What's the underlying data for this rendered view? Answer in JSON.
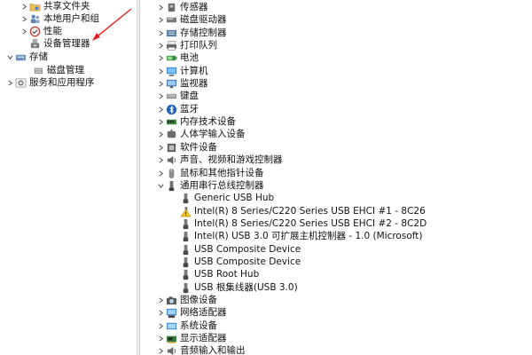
{
  "left_tree": {
    "items": [
      {
        "label": "共享文件夹",
        "icon": "shared-folder-icon",
        "expander": "collapsed"
      },
      {
        "label": "本地用户和组",
        "icon": "users-icon",
        "expander": "collapsed"
      },
      {
        "label": "性能",
        "icon": "performance-icon",
        "expander": "collapsed"
      },
      {
        "label": "设备管理器",
        "icon": "device-manager-icon",
        "expander": "none",
        "selected": false
      },
      {
        "label": "存储",
        "icon": "storage-icon",
        "expander": "expanded"
      },
      {
        "label": "磁盘管理",
        "icon": "disk-management-icon",
        "expander": "none"
      },
      {
        "label": "服务和应用程序",
        "icon": "services-icon",
        "expander": "collapsed"
      }
    ],
    "annotation_arrow_color": "#e02020"
  },
  "device_tree": {
    "categories_top": [
      {
        "label": "传感器",
        "icon": "sensor-icon"
      },
      {
        "label": "磁盘驱动器",
        "icon": "disk-drive-icon"
      },
      {
        "label": "存储控制器",
        "icon": "storage-controller-icon"
      },
      {
        "label": "打印队列",
        "icon": "printer-icon"
      },
      {
        "label": "电池",
        "icon": "battery-icon"
      },
      {
        "label": "计算机",
        "icon": "computer-icon"
      },
      {
        "label": "监视器",
        "icon": "monitor-icon"
      },
      {
        "label": "键盘",
        "icon": "keyboard-icon"
      },
      {
        "label": "蓝牙",
        "icon": "bluetooth-icon"
      },
      {
        "label": "内存技术设备",
        "icon": "memory-device-icon"
      },
      {
        "label": "人体学输入设备",
        "icon": "hid-icon"
      },
      {
        "label": "软件设备",
        "icon": "software-device-icon"
      },
      {
        "label": "声音、视频和游戏控制器",
        "icon": "sound-icon"
      },
      {
        "label": "鼠标和其他指针设备",
        "icon": "mouse-icon"
      }
    ],
    "usb_category": {
      "label": "通用串行总线控制器",
      "icon": "usb-icon",
      "expander": "expanded"
    },
    "usb_children": [
      {
        "label": "Generic USB Hub",
        "icon": "usb-device-icon"
      },
      {
        "label": "Intel(R) 8 Series/C220 Series USB EHCI #1 - 8C26",
        "icon": "warning-usb-icon"
      },
      {
        "label": "Intel(R) 8 Series/C220 Series USB EHCI #2 - 8C2D",
        "icon": "usb-device-icon"
      },
      {
        "label": "Intel(R) USB 3.0 可扩展主机控制器 - 1.0 (Microsoft)",
        "icon": "usb-device-icon"
      },
      {
        "label": "USB Composite Device",
        "icon": "usb-device-icon"
      },
      {
        "label": "USB Composite Device",
        "icon": "usb-device-icon"
      },
      {
        "label": "USB Root Hub",
        "icon": "usb-device-icon"
      },
      {
        "label": "USB 根集线器(USB 3.0)",
        "icon": "usb-device-icon"
      }
    ],
    "categories_bottom": [
      {
        "label": "图像设备",
        "icon": "camera-icon"
      },
      {
        "label": "网络适配器",
        "icon": "network-adapter-icon"
      },
      {
        "label": "系统设备",
        "icon": "system-device-icon"
      },
      {
        "label": "显示适配器",
        "icon": "display-adapter-icon"
      },
      {
        "label": "音频输入和输出",
        "icon": "audio-io-icon"
      }
    ]
  }
}
